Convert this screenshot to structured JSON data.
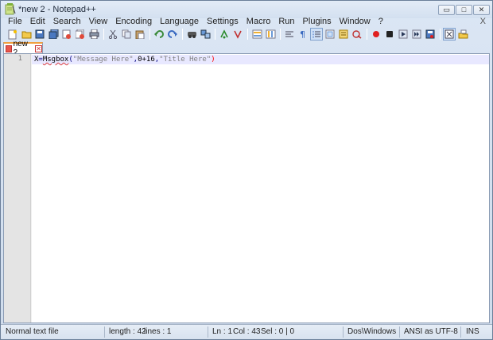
{
  "window": {
    "title": "*new  2 - Notepad++",
    "minimize_glyph": "▭",
    "maximize_glyph": "□",
    "close_glyph": "✕"
  },
  "menu": {
    "items": [
      "File",
      "Edit",
      "Search",
      "View",
      "Encoding",
      "Language",
      "Settings",
      "Macro",
      "Run",
      "Plugins",
      "Window",
      "?"
    ],
    "close": "X"
  },
  "toolbar": {
    "icons": [
      "new-file-icon",
      "open-file-icon",
      "save-icon",
      "save-all-icon",
      "close-icon",
      "close-all-icon",
      "print-icon",
      "cut-icon",
      "copy-icon",
      "paste-icon",
      "undo-icon",
      "redo-icon",
      "find-icon",
      "replace-icon",
      "zoom-in-icon",
      "zoom-out-icon",
      "sync-vertical-icon",
      "sync-horizontal-icon",
      "word-wrap-icon",
      "show-all-chars-icon",
      "indent-guide-icon",
      "doc-map-icon",
      "function-list-icon",
      "folder-workspace-icon",
      "record-macro-icon",
      "stop-record-icon",
      "play-macro-icon",
      "run-macro-multiple-icon",
      "save-macro-icon",
      "launch-in-browser-icon",
      "tray-icon"
    ]
  },
  "tab": {
    "label": "new  2",
    "close_glyph": "✕"
  },
  "editor": {
    "line_number": "1",
    "code": {
      "var": "X",
      "eq": "=",
      "func": "Msgbox",
      "open": "(",
      "arg1": "\"Message Here\"",
      "comma1": ",",
      "arg2": "0+16",
      "comma2": ",",
      "arg3": "\"Title Here\"",
      "close": ")"
    }
  },
  "status": {
    "file_type": "Normal text file",
    "length": "length : 42",
    "lines": "lines : 1",
    "ln": "Ln : 1",
    "col": "Col : 43",
    "sel": "Sel : 0 | 0",
    "eol": "Dos\\Windows",
    "encoding": "ANSI as UTF-8",
    "mode": "INS"
  },
  "colors": {
    "accent": "#f0a040",
    "line_highlight": "#e8e8ff",
    "string": "#808080",
    "operator": "#000080"
  }
}
